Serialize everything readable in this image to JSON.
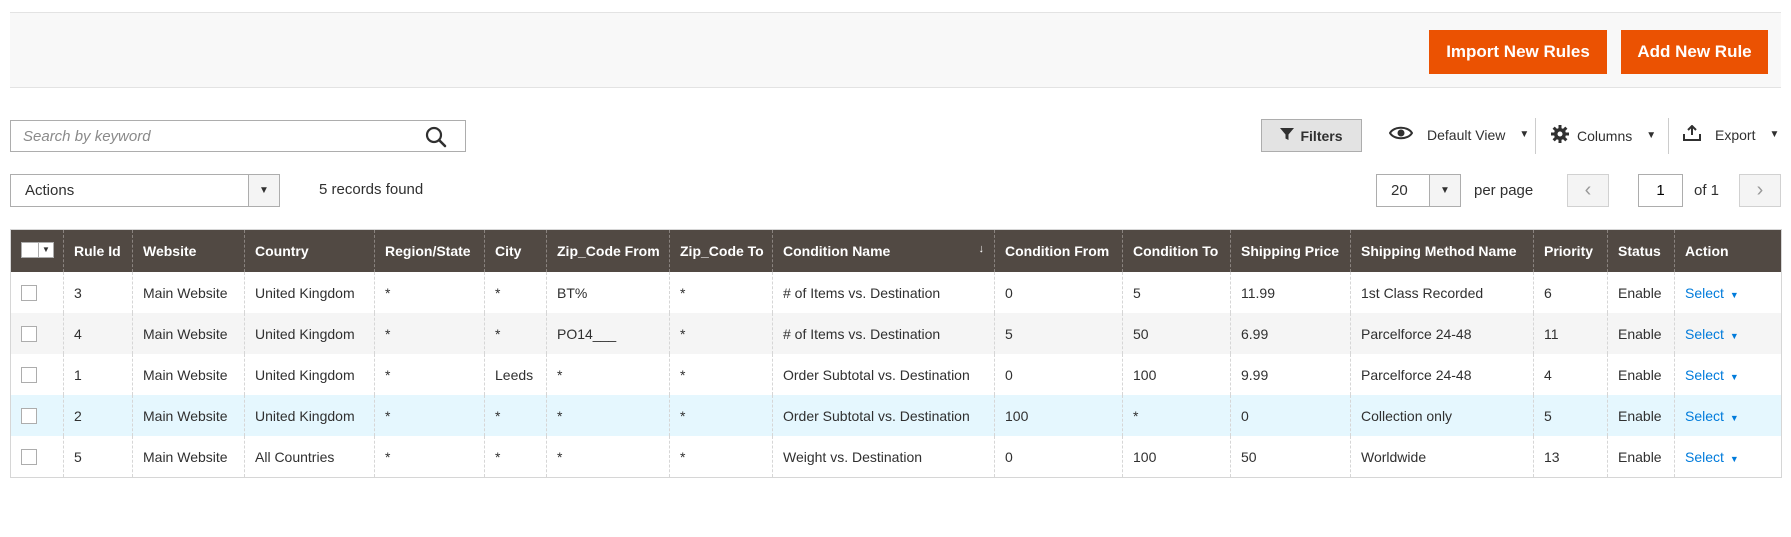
{
  "header": {
    "import_button": "Import New Rules",
    "add_button": "Add New Rule"
  },
  "toolbar": {
    "search_placeholder": "Search by keyword",
    "filters_label": "Filters",
    "view_label": "Default View",
    "columns_label": "Columns",
    "export_label": "Export",
    "actions_label": "Actions",
    "records_found": "5 records found",
    "per_page_value": "20",
    "per_page_label": "per page",
    "current_page": "1",
    "page_of": "of 1"
  },
  "colors": {
    "accent": "#eb5202",
    "header_bg": "#514943",
    "link": "#007bdb",
    "highlight_row": "#e5f7fe"
  },
  "table": {
    "columns": [
      "Rule Id",
      "Website",
      "Country",
      "Region/State",
      "City",
      "Zip_Code From",
      "Zip_Code To",
      "Condition Name",
      "Condition From",
      "Condition To",
      "Shipping Price",
      "Shipping Method Name",
      "Priority",
      "Status",
      "Action"
    ],
    "sorted_column_indicator": "↓",
    "rows": [
      {
        "rule_id": "3",
        "website": "Main Website",
        "country": "United Kingdom",
        "region": "*",
        "city": "*",
        "zip_from": "BT%",
        "zip_to": "*",
        "condition": "# of Items vs. Destination",
        "cond_from": "0",
        "cond_to": "5",
        "price": "11.99",
        "method": "1st Class Recorded",
        "priority": "6",
        "status": "Enable",
        "action": "Select"
      },
      {
        "rule_id": "4",
        "website": "Main Website",
        "country": "United Kingdom",
        "region": "*",
        "city": "*",
        "zip_from": "PO14___",
        "zip_to": "*",
        "condition": "# of Items vs. Destination",
        "cond_from": "5",
        "cond_to": "50",
        "price": "6.99",
        "method": "Parcelforce 24-48",
        "priority": "11",
        "status": "Enable",
        "action": "Select"
      },
      {
        "rule_id": "1",
        "website": "Main Website",
        "country": "United Kingdom",
        "region": "*",
        "city": "Leeds",
        "zip_from": "*",
        "zip_to": "*",
        "condition": "Order Subtotal vs. Destination",
        "cond_from": "0",
        "cond_to": "100",
        "price": "9.99",
        "method": "Parcelforce 24-48",
        "priority": "4",
        "status": "Enable",
        "action": "Select"
      },
      {
        "rule_id": "2",
        "website": "Main Website",
        "country": "United Kingdom",
        "region": "*",
        "city": "*",
        "zip_from": "*",
        "zip_to": "*",
        "condition": "Order Subtotal vs. Destination",
        "cond_from": "100",
        "cond_to": "*",
        "price": "0",
        "method": "Collection only",
        "priority": "5",
        "status": "Enable",
        "action": "Select"
      },
      {
        "rule_id": "5",
        "website": "Main Website",
        "country": "All Countries",
        "region": "*",
        "city": "*",
        "zip_from": "*",
        "zip_to": "*",
        "condition": "Weight vs. Destination",
        "cond_from": "0",
        "cond_to": "100",
        "price": "50",
        "method": "Worldwide",
        "priority": "13",
        "status": "Enable",
        "action": "Select"
      }
    ]
  },
  "icons": {
    "search": "search-icon",
    "filter": "filter-icon",
    "view": "eye-icon",
    "columns": "gear-icon",
    "export": "export-icon"
  }
}
